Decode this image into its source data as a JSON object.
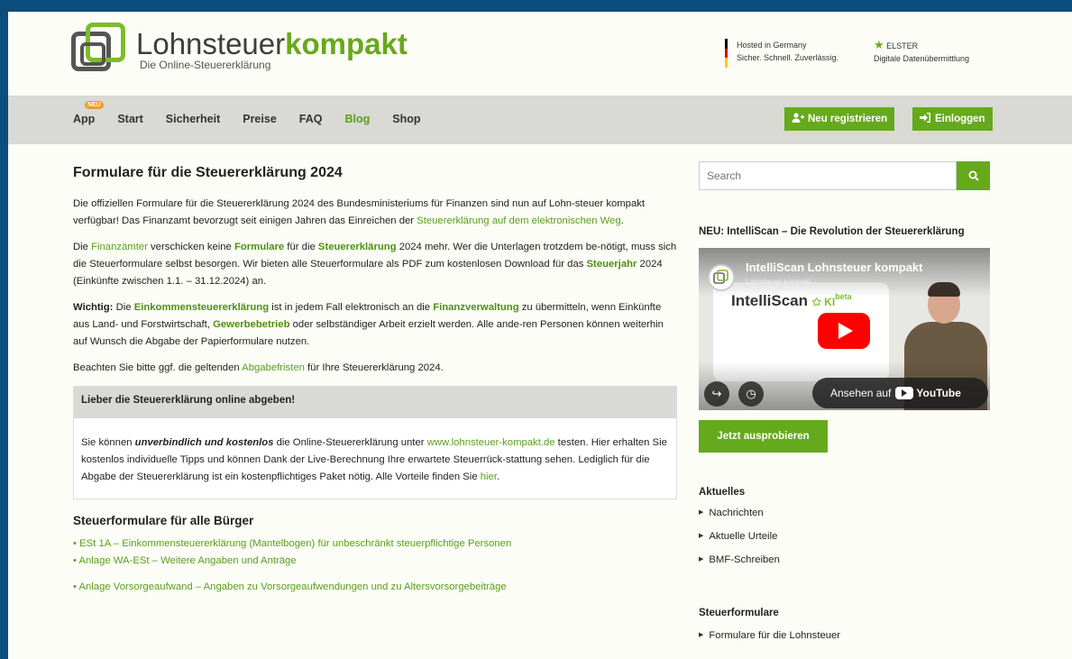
{
  "header": {
    "logo_title_plain": "Lohnsteuer",
    "logo_title_bold": "kompakt",
    "logo_sub": "Die Online-Steuererklärung",
    "badge1_line1": "Hosted in Germany",
    "badge1_line2": "Sicher. Schnell. Zuverlässig.",
    "badge2_line1": "ELSTER",
    "badge2_line2": "Digitale Datenübermittlung"
  },
  "nav": {
    "items": [
      {
        "label": "App",
        "badge": "NEU"
      },
      {
        "label": "Start"
      },
      {
        "label": "Sicherheit"
      },
      {
        "label": "Preise"
      },
      {
        "label": "FAQ"
      },
      {
        "label": "Blog"
      },
      {
        "label": "Shop"
      }
    ],
    "register_label": "Neu registrieren",
    "login_label": "Einloggen"
  },
  "main": {
    "title": "Formulare für die Steuererklärung 2024",
    "p1_a": "Die offiziellen Formulare für die Steuererklärung 2024 des Bundesministeriums für Finanzen sind nun auf Lohn-steuer kompakt verfügbar! Das Finanzamt bevorzugt seit einigen Jahren das Einreichen der ",
    "p1_link": "Steuererklärung auf dem elektronischen Weg",
    "p1_b": ".",
    "p2_l1": "Finanzämter",
    "p2_t1": " verschicken keine ",
    "p2_l2": "Formulare",
    "p2_t2": " für die ",
    "p2_l3": "Steuererklärung",
    "p2_t3": " 2024 mehr. Wer die Unterlagen trotzdem be-nötigt, muss sich die Steuerformulare selbst besorgen. Wir bieten alle Steuerformulare als PDF zum kostenlosen Download für das ",
    "p2_l4": "Steuerjahr",
    "p2_t4": " 2024 (Einkünfte zwischen 1.1. – 31.12.2024) an.",
    "p2_prefix": "Die ",
    "p3_bold": "Wichtig:",
    "p3_t0": " Die ",
    "p3_l1": "Einkommensteuererklärung",
    "p3_t1": " ist in jedem Fall elektronisch an die ",
    "p3_l2": "Finanzverwaltung",
    "p3_t2": " zu übermitteln, wenn Einkünfte aus Land- und Forstwirtschaft, ",
    "p3_l3": "Gewerbebetrieb",
    "p3_t3": " oder selbständiger Arbeit erzielt werden. Alle ande-ren Personen können weiterhin auf Wunsch die Abgabe der Papierformulare nutzen.",
    "p4_a": "Beachten Sie bitte ggf. die geltenden ",
    "p4_link": "Abgabefristen",
    "p4_b": " für Ihre Steuererklärung 2024.",
    "box_title": "Lieber die Steuererklärung online abgeben!",
    "box_a": "Sie können ",
    "box_em": "unverbindlich und kostenlos",
    "box_b": " die Online-Steuererklärung unter ",
    "box_link": "www.lohnsteuer-kompakt.de",
    "box_c": " testen. Hier erhalten Sie kostenlos individuelle Tipps und können Dank der Live-Berechnung Ihre erwartete Steuerrück-stattung sehen. Lediglich für die Abgabe der Steuererklärung ist ein kostenpflichtiges Paket nötig. Alle Vorteile finden Sie ",
    "box_link2": "hier",
    "box_d": ".",
    "h2": "Steuerformulare für alle Bürger",
    "list": [
      "• ESt 1A – Einkommensteuererklärung (Mantelbogen) für unbeschränkt steuerpflichtige Personen",
      "• Anlage WA-ESt – Weitere Angaben und Anträge",
      "• Anlage Vorsorgeaufwand – Angaben zu Vorsorgeaufwendungen und zu Altersvorsorgebeiträge"
    ]
  },
  "sidebar": {
    "search_placeholder": "Search",
    "video_heading": "NEU: IntelliScan – Die Revolution der Steuererklärung",
    "video_title": "IntelliScan Lohnsteuer kompakt",
    "video_channel": "Lohnsteuer kompakt",
    "video_brand": "IntelliScan",
    "video_ki": "KI",
    "video_beta": "beta",
    "watch_label": "Ansehen auf",
    "youtube_label": "YouTube",
    "try_label": "Jetzt ausprobieren",
    "news_heading": "Aktuelles",
    "news_items": [
      "Nachrichten",
      "Aktuelle Urteile",
      "BMF-Schreiben"
    ],
    "forms_heading": "Steuerformulare",
    "forms_items": [
      "Formulare für die Lohnsteuer"
    ]
  }
}
